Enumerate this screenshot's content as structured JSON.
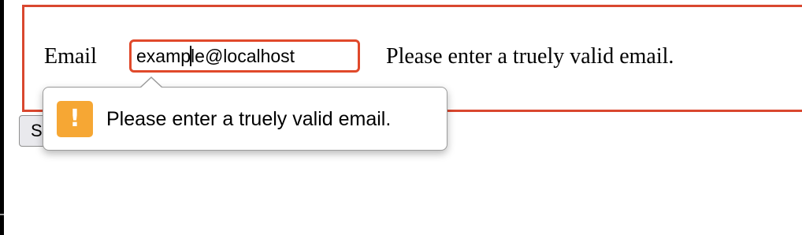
{
  "form": {
    "email_label": "Email",
    "email_value_before_caret": "examp",
    "email_value_after_caret": "le@localhost",
    "inline_error": "Please enter a truely valid email.",
    "submit_label": "Submit"
  },
  "tooltip": {
    "icon": "warning-icon",
    "icon_glyph": "!",
    "message": "Please enter a truely valid email."
  },
  "colors": {
    "form_border": "#d9472f",
    "input_invalid_border": "#e0492b",
    "warning_icon_bg": "#f6a734"
  }
}
